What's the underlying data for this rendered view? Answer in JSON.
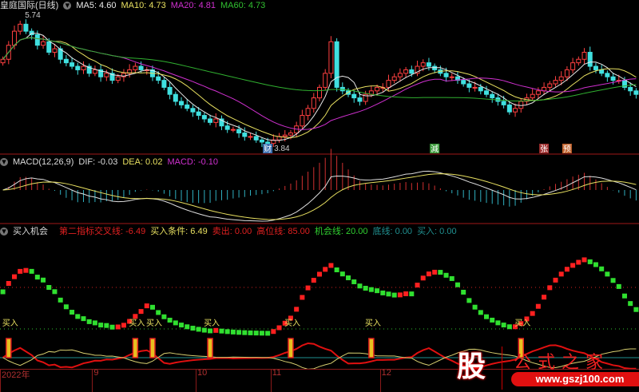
{
  "price_panel": {
    "stock_name": "皇庭国际(日线)",
    "ma5": "MA5: 4.60",
    "ma10": "MA10: 4.73",
    "ma20": "MA20: 4.81",
    "ma60": "MA60: 4.73",
    "high_label": "5.74",
    "low_label": "3.84",
    "markers": [
      {
        "text": "财",
        "index": 46,
        "color": "#3a6fb0"
      },
      {
        "text": "減",
        "index": 75,
        "color": "#3a9a3a"
      },
      {
        "text": "张",
        "index": 94,
        "color": "#a03030"
      },
      {
        "text": "预",
        "index": 98,
        "color": "#c0602a"
      }
    ],
    "colors": {
      "ma5": "#e8e8e8",
      "ma10": "#e8e060",
      "ma20": "#d030d0",
      "ma60": "#30b030",
      "up": "#ff4040",
      "down": "#40e0e0"
    }
  },
  "macd_panel": {
    "title": "MACD(12,26,9)",
    "dif": "DIF: -0.03",
    "dea": "DEA: 0.02",
    "macd": "MACD: -0.10"
  },
  "signal_panel": {
    "title": "买入机会",
    "cross": "第二指标交叉线: -6.49",
    "cond": "买入条件: 6.49",
    "sell": "卖出: 0.00",
    "high_line": "高位线: 85.00",
    "chance_line": "机会线: 20.00",
    "bottom_line": "底线: 0.00",
    "buy": "买入: 0.00",
    "buy_label": "买入",
    "buy_indices": [
      1,
      23,
      26,
      36,
      50,
      64,
      90
    ]
  },
  "closes": [
    5.1,
    5.3,
    5.5,
    5.6,
    5.5,
    5.45,
    5.3,
    5.35,
    5.2,
    5.25,
    5.1,
    5.05,
    5.0,
    4.95,
    5.0,
    4.9,
    4.95,
    4.85,
    4.9,
    4.8,
    4.85,
    4.9,
    4.95,
    5.0,
    4.95,
    4.95,
    4.85,
    4.8,
    4.7,
    4.6,
    4.5,
    4.45,
    4.4,
    4.35,
    4.3,
    4.25,
    4.2,
    4.25,
    4.15,
    4.1,
    4.1,
    4.05,
    4.0,
    4.0,
    3.95,
    3.92,
    3.9,
    3.95,
    4.0,
    4.02,
    4.05,
    4.15,
    4.3,
    4.4,
    4.55,
    4.7,
    4.9,
    5.35,
    4.7,
    4.65,
    4.6,
    4.55,
    4.5,
    4.6,
    4.65,
    4.7,
    4.7,
    4.8,
    4.85,
    4.9,
    4.95,
    4.9,
    5.0,
    5.05,
    5.0,
    4.95,
    4.9,
    4.85,
    4.85,
    4.8,
    4.75,
    4.7,
    4.7,
    4.65,
    4.6,
    4.55,
    4.5,
    4.45,
    4.35,
    4.4,
    4.5,
    4.55,
    4.6,
    4.65,
    4.7,
    4.75,
    4.8,
    4.85,
    4.95,
    5.05,
    5.1,
    5.2,
    5.0,
    4.95,
    4.9,
    4.85,
    4.8,
    4.8,
    4.7,
    4.65,
    4.6
  ],
  "x_axis": {
    "labels": [
      {
        "text": "2022年",
        "index": 0
      },
      {
        "text": "9",
        "index": 16
      },
      {
        "text": "10",
        "index": 34
      },
      {
        "text": "11",
        "index": 47
      },
      {
        "text": "12",
        "index": 66
      }
    ]
  },
  "logo": {
    "char": "股",
    "name": "公式之家",
    "url": "www.gszj100.com"
  }
}
